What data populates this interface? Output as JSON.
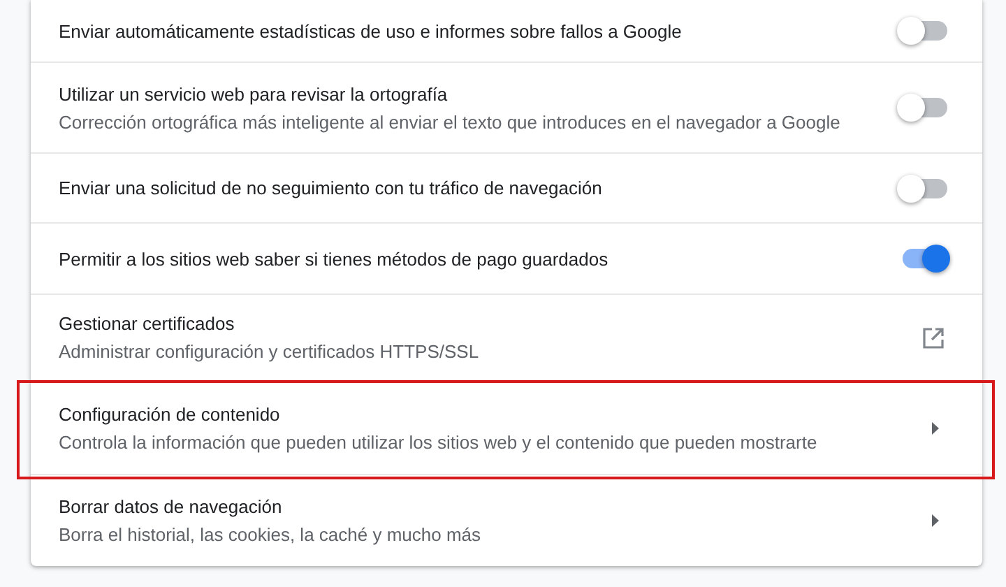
{
  "settings": [
    {
      "kind": "toggle",
      "title": "Enviar automáticamente estadísticas de uso e informes sobre fallos a Google",
      "on": false,
      "highlighted": false
    },
    {
      "kind": "toggle",
      "title": "Utilizar un servicio web para revisar la ortografía",
      "subtitle": "Corrección ortográfica más inteligente al enviar el texto que introduces en el navegador a Google",
      "on": false,
      "highlighted": false
    },
    {
      "kind": "toggle",
      "title": "Enviar una solicitud de no seguimiento con tu tráfico de navegación",
      "on": false,
      "highlighted": false
    },
    {
      "kind": "toggle",
      "title": "Permitir a los sitios web saber si tienes métodos de pago guardados",
      "on": true,
      "highlighted": false
    },
    {
      "kind": "external",
      "title": "Gestionar certificados",
      "subtitle": "Administrar configuración y certificados HTTPS/SSL",
      "highlighted": false
    },
    {
      "kind": "arrow",
      "title": "Configuración de contenido",
      "subtitle": "Controla la información que pueden utilizar los sitios web y el contenido que pueden mostrarte",
      "highlighted": true
    },
    {
      "kind": "arrow",
      "title": "Borrar datos de navegación",
      "subtitle": "Borra el historial, las cookies, la caché y mucho más",
      "highlighted": false
    }
  ]
}
